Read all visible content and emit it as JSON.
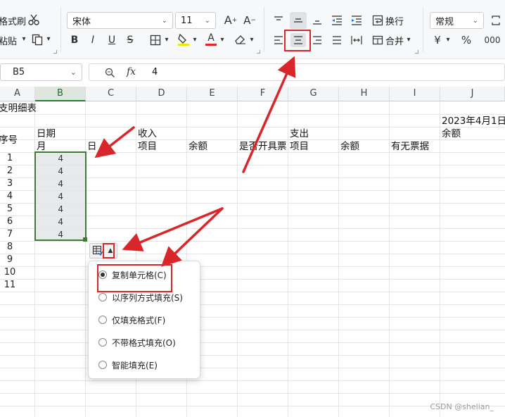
{
  "ribbon": {
    "format_painter": "格式刷",
    "paste": "粘贴",
    "font_name": "宋体",
    "font_size": "11",
    "wrap_text": "换行",
    "merge": "合并",
    "number_format": "常规",
    "bold": "B",
    "italic": "I",
    "underline": "U",
    "strike": "S",
    "font_color_glyph": "A",
    "currency": "¥",
    "percent": "%",
    "thousands": "000"
  },
  "formula_bar": {
    "name_box": "B5",
    "fx_label": "fx",
    "value": "4"
  },
  "columns": [
    "A",
    "B",
    "C",
    "D",
    "E",
    "F",
    "G",
    "H",
    "I",
    "J"
  ],
  "sheet": {
    "title_fragment": "支明细表",
    "date": "2023年4月1日",
    "balance_top": "余额",
    "seq": "序号",
    "date_header": "日期",
    "month": "月",
    "day": "日",
    "income": "收入",
    "item": "项目",
    "balance": "余额",
    "invoice_issued": "是否开具票",
    "expense": "支出",
    "item2": "项目",
    "balance2": "余额",
    "has_receipt": "有无票据",
    "row_numbers": [
      "1",
      "2",
      "3",
      "4",
      "5",
      "6",
      "7",
      "8",
      "9",
      "10",
      "11"
    ],
    "month_values": [
      "4",
      "4",
      "4",
      "4",
      "4",
      "4",
      "4"
    ]
  },
  "autofill_menu": {
    "options": [
      {
        "label": "复制单元格(C)",
        "selected": true
      },
      {
        "label": "以序列方式填充(S)",
        "selected": false
      },
      {
        "label": "仅填充格式(F)",
        "selected": false
      },
      {
        "label": "不带格式填充(O)",
        "selected": false
      },
      {
        "label": "智能填充(E)",
        "selected": false
      }
    ]
  },
  "watermark": "CSDN @shelian_",
  "colors": {
    "selection_border": "#3a7d33",
    "annotation_red": "#d9262b",
    "font_color_bar": "#e0262b",
    "highlight_bar": "#f2e600"
  }
}
